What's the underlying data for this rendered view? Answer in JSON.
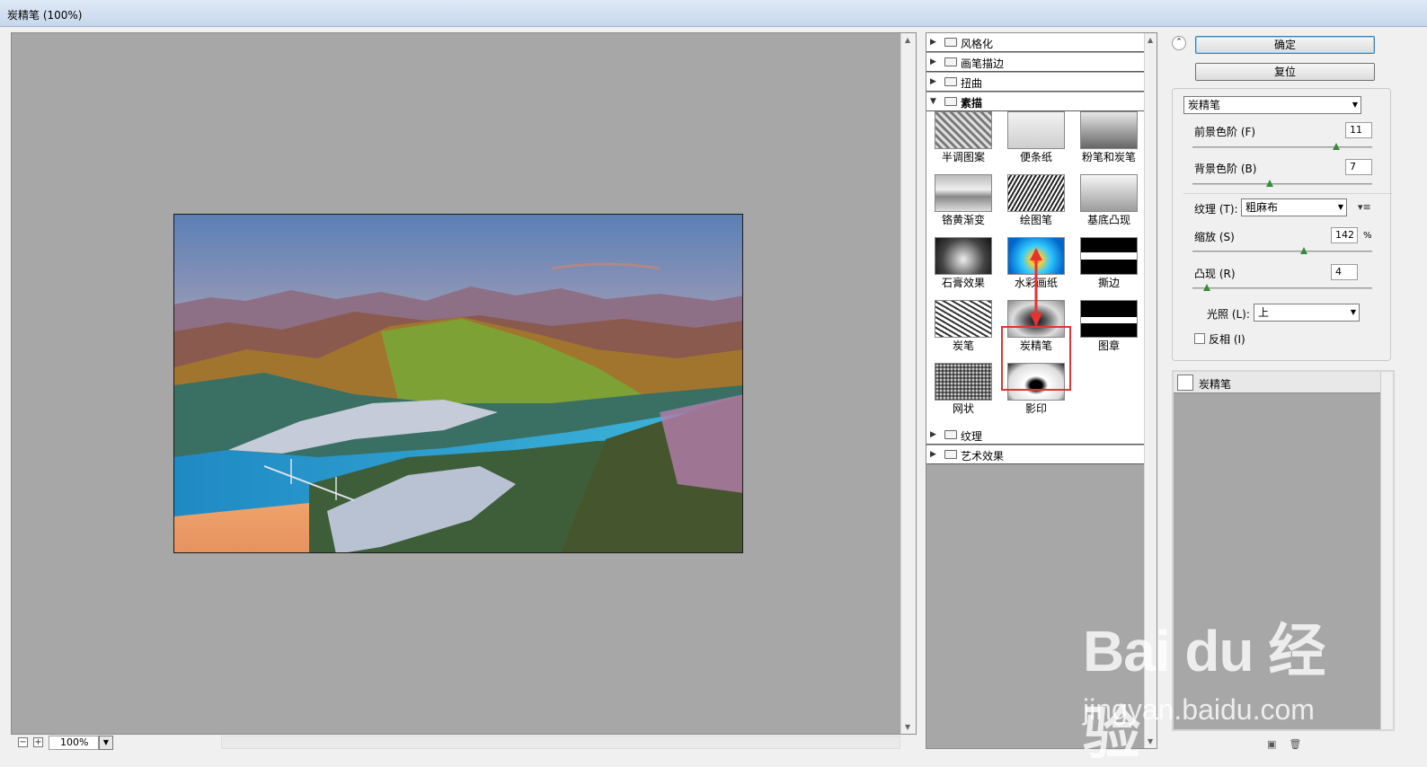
{
  "window": {
    "title": "炭精笔 (100%)"
  },
  "preview": {
    "zoom": "100%"
  },
  "filters": {
    "categories_top": [
      {
        "label": "风格化",
        "expanded": false
      },
      {
        "label": "画笔描边",
        "expanded": false
      },
      {
        "label": "扭曲",
        "expanded": false
      },
      {
        "label": "素描",
        "expanded": true
      }
    ],
    "sketch_items": [
      "半调图案",
      "便条纸",
      "粉笔和炭笔",
      "铬黄渐变",
      "绘图笔",
      "基底凸现",
      "石膏效果",
      "水彩画纸",
      "撕边",
      "炭笔",
      "炭精笔",
      "图章",
      "网状",
      "影印"
    ],
    "selected_item": "炭精笔",
    "categories_bottom": [
      {
        "label": "纹理",
        "expanded": false
      },
      {
        "label": "艺术效果",
        "expanded": false
      }
    ]
  },
  "buttons": {
    "ok": "确定",
    "reset": "复位"
  },
  "settings": {
    "filter_select": "炭精笔",
    "foreground_level": {
      "label": "前景色阶 (F)",
      "value": "11",
      "fraction": 0.8
    },
    "background_level": {
      "label": "背景色阶 (B)",
      "value": "7",
      "fraction": 0.43
    },
    "texture": {
      "label": "纹理 (T):",
      "value": "粗麻布"
    },
    "scaling": {
      "label": "缩放 (S)",
      "value": "142",
      "unit": "%",
      "fraction": 0.62
    },
    "relief": {
      "label": "凸现 (R)",
      "value": "4",
      "fraction": 0.08
    },
    "light": {
      "label": "光照 (L):",
      "value": "上"
    },
    "invert": {
      "label": "反相 (I)",
      "checked": false
    }
  },
  "layers": {
    "item": "炭精笔"
  },
  "watermark": {
    "main": "Bai  du 经验",
    "sub": "jingyan.baidu.com"
  }
}
